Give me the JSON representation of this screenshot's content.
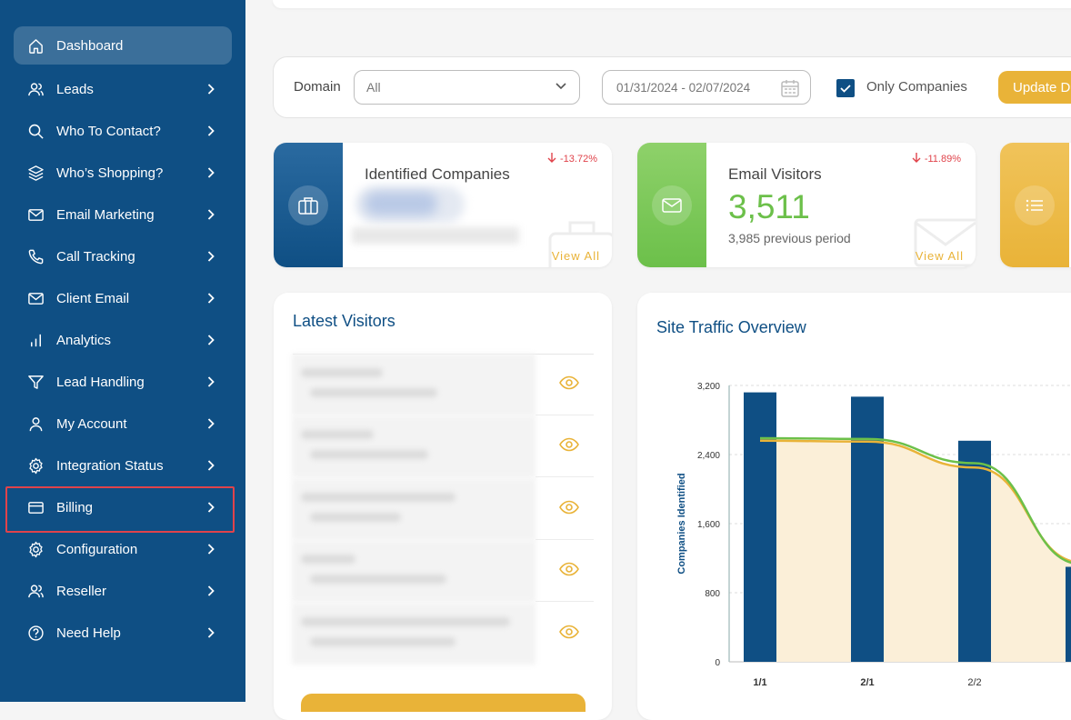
{
  "sidebar": {
    "items": [
      {
        "label": "Dashboard",
        "icon": "home-icon"
      },
      {
        "label": "Leads",
        "icon": "users-icon"
      },
      {
        "label": "Who To Contact?",
        "icon": "search-icon"
      },
      {
        "label": "Who’s Shopping?",
        "icon": "layers-icon"
      },
      {
        "label": "Email Marketing",
        "icon": "mail-icon"
      },
      {
        "label": "Call Tracking",
        "icon": "phone-icon"
      },
      {
        "label": "Client Email",
        "icon": "mail-icon"
      },
      {
        "label": "Analytics",
        "icon": "bar-chart-icon"
      },
      {
        "label": "Lead Handling",
        "icon": "filter-icon"
      },
      {
        "label": "My Account",
        "icon": "user-icon"
      },
      {
        "label": "Integration Status",
        "icon": "gear-icon"
      },
      {
        "label": "Billing",
        "icon": "credit-card-icon"
      },
      {
        "label": "Configuration",
        "icon": "gear-icon"
      },
      {
        "label": "Reseller",
        "icon": "users-icon"
      },
      {
        "label": "Need Help",
        "icon": "help-circle-icon"
      }
    ]
  },
  "filters": {
    "domain_label": "Domain",
    "domain_value": "All",
    "date_range": "01/31/2024 - 02/07/2024",
    "only_companies_label": "Only Companies",
    "only_companies_checked": true,
    "update_button": "Update D"
  },
  "cards": {
    "identified": {
      "title": "Identified Companies",
      "change": "-13.72%",
      "view_all": "View All"
    },
    "email": {
      "title": "Email Visitors",
      "value": "3,511",
      "previous": "3,985 previous period",
      "change": "-11.89%",
      "view_all": "View All"
    }
  },
  "latest_visitors": {
    "title": "Latest Visitors"
  },
  "site_traffic": {
    "title": "Site Traffic Overview"
  },
  "chart_data": {
    "type": "bar",
    "ylabel": "Companies Identified",
    "yticks": [
      "0",
      "800",
      "1,600",
      "2,400",
      "3,200"
    ],
    "ylim": [
      0,
      3200
    ],
    "categories": [
      "1/1",
      "2/1",
      "2/2",
      ""
    ],
    "series": [
      {
        "values": [
          3120,
          3070,
          2560,
          1100
        ]
      }
    ],
    "lines": [
      {
        "values": [
          2560,
          2550,
          2250,
          1150
        ]
      },
      {
        "values": [
          2590,
          2580,
          2300,
          1130
        ]
      }
    ],
    "colors": {
      "bar": "#0f4f84",
      "area": "#fbefd8",
      "line1": "#e9b338",
      "line2": "#6cc04a"
    }
  },
  "colors": {
    "sidebar": "#0f4f84",
    "accent": "#e9b338",
    "green": "#6cc04a",
    "danger": "#e0434b"
  }
}
